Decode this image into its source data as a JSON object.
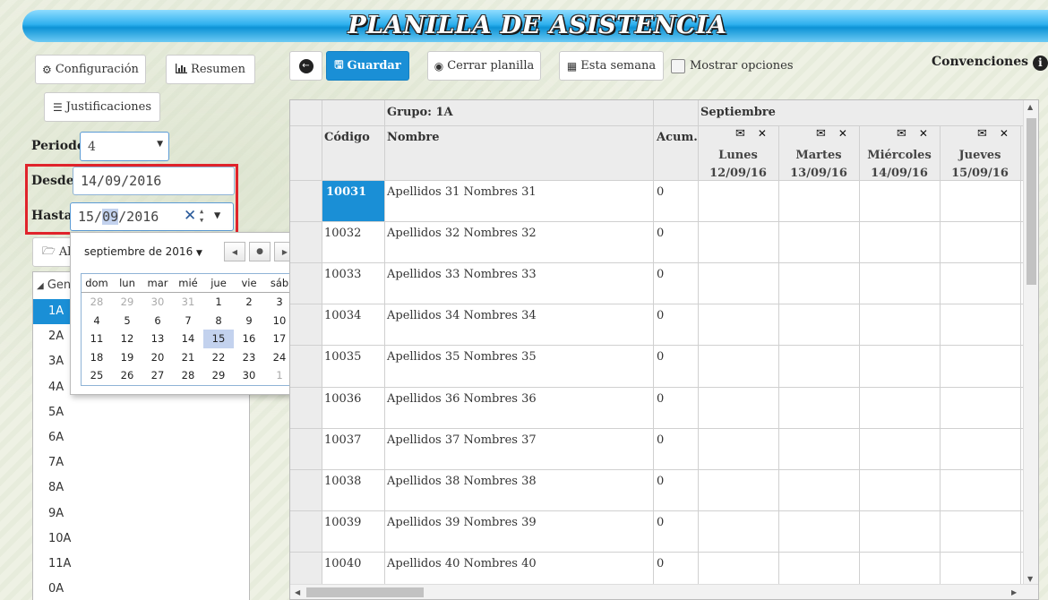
{
  "header": {
    "title": "PLANILLA DE ASISTENCIA"
  },
  "toolbar_left": {
    "configuracion": "Configuración",
    "resumen": "Resumen",
    "justificaciones": "Justificaciones"
  },
  "toolbar_main": {
    "back_icon": "circle-arrow-left-icon",
    "guardar": "Guardar",
    "cerrar": "Cerrar planilla",
    "esta_semana": "Esta semana",
    "mostrar_opciones": "Mostrar opciones",
    "convenciones": "Convenciones"
  },
  "filters": {
    "periodo_label": "Periodo",
    "periodo_value": "4",
    "desde_label": "Desde",
    "desde_value": "14/09/2016",
    "hasta_label": "Hasta",
    "hasta_day": "15/",
    "hasta_month": "09",
    "hasta_year": "/2016",
    "open_button_partial": "Al"
  },
  "tree": {
    "root": "Gene",
    "groups": [
      "1A",
      "2A",
      "3A",
      "4A",
      "5A",
      "6A",
      "7A",
      "8A",
      "9A",
      "10A",
      "11A",
      "0A"
    ]
  },
  "calendar": {
    "month_label": "septiembre de 2016",
    "weekdays": [
      "dom",
      "lun",
      "mar",
      "mié",
      "jue",
      "vie",
      "sáb"
    ],
    "weeks": [
      [
        "28",
        "29",
        "30",
        "31",
        "1",
        "2",
        "3"
      ],
      [
        "4",
        "5",
        "6",
        "7",
        "8",
        "9",
        "10"
      ],
      [
        "11",
        "12",
        "13",
        "14",
        "15",
        "16",
        "17"
      ],
      [
        "18",
        "19",
        "20",
        "21",
        "22",
        "23",
        "24"
      ],
      [
        "25",
        "26",
        "27",
        "28",
        "29",
        "30",
        "1"
      ]
    ],
    "today": "15"
  },
  "table": {
    "grupo": "Grupo: 1A",
    "month": "Septiembre",
    "col_codigo": "Código",
    "col_nombre": "Nombre",
    "col_acum": "Acum.",
    "days": [
      {
        "name": "Lunes",
        "date": "12/09/16"
      },
      {
        "name": "Martes",
        "date": "13/09/16"
      },
      {
        "name": "Miércoles",
        "date": "14/09/16"
      },
      {
        "name": "Jueves",
        "date": "15/09/16"
      }
    ],
    "rows": [
      {
        "codigo": "10031",
        "nombre": "Apellidos 31 Nombres 31",
        "acum": "0"
      },
      {
        "codigo": "10032",
        "nombre": "Apellidos 32 Nombres 32",
        "acum": "0"
      },
      {
        "codigo": "10033",
        "nombre": "Apellidos 33 Nombres 33",
        "acum": "0"
      },
      {
        "codigo": "10034",
        "nombre": "Apellidos 34 Nombres 34",
        "acum": "0"
      },
      {
        "codigo": "10035",
        "nombre": "Apellidos 35 Nombres 35",
        "acum": "0"
      },
      {
        "codigo": "10036",
        "nombre": "Apellidos 36 Nombres 36",
        "acum": "0"
      },
      {
        "codigo": "10037",
        "nombre": "Apellidos 37 Nombres 37",
        "acum": "0"
      },
      {
        "codigo": "10038",
        "nombre": "Apellidos 38 Nombres 38",
        "acum": "0"
      },
      {
        "codigo": "10039",
        "nombre": "Apellidos 39 Nombres 39",
        "acum": "0"
      },
      {
        "codigo": "10040",
        "nombre": "Apellidos 40 Nombres 40",
        "acum": "0"
      }
    ]
  },
  "colors": {
    "accent": "#1a8fd6",
    "highlight": "#e0232b",
    "today": "#c3d2ee"
  }
}
